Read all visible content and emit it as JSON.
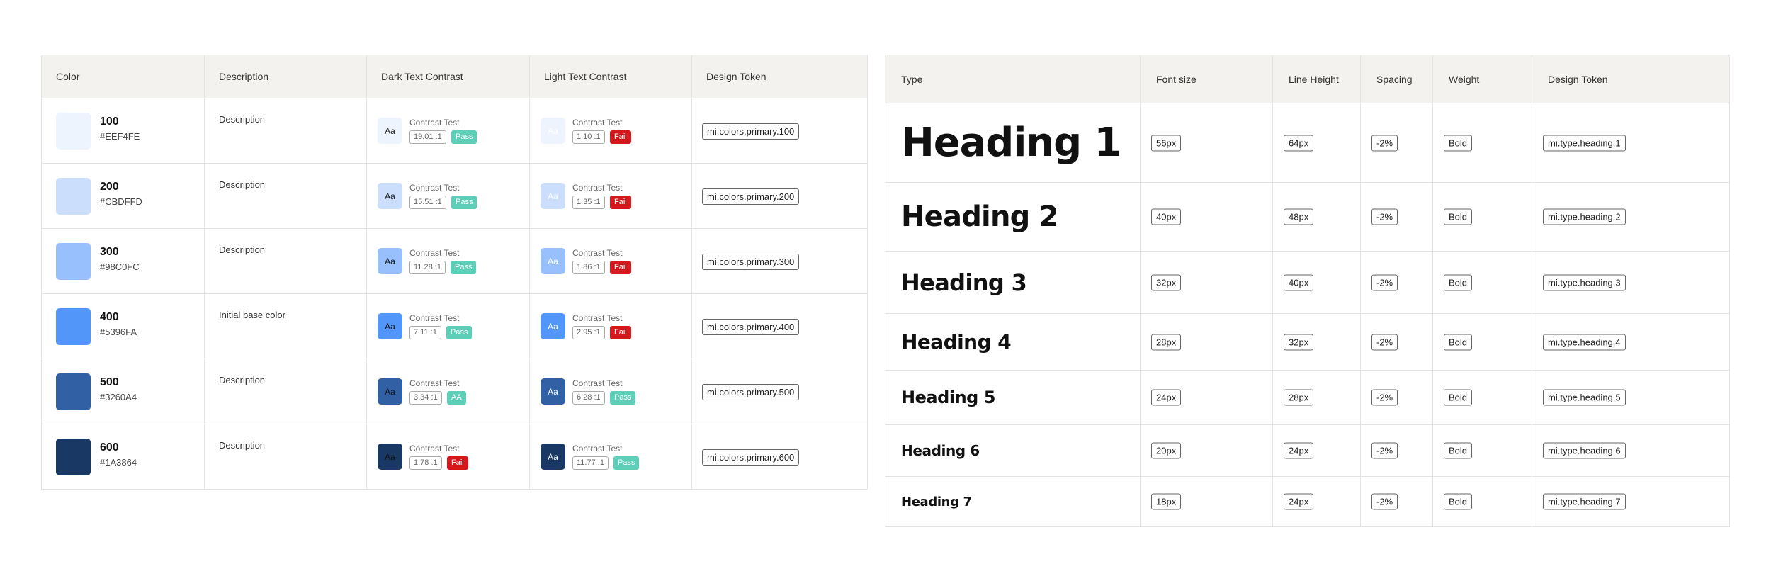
{
  "color_table": {
    "headers": {
      "color": "Color",
      "description": "Description",
      "dark": "Dark Text Contrast",
      "light": "Light Text Contrast",
      "token": "Design Token"
    },
    "rows": [
      {
        "shade": "100",
        "hex": "#EEF4FE",
        "description": "Description",
        "dark": {
          "chip": "Aa",
          "label": "Contrast Test",
          "ratio": "19.01 :1",
          "badge": "Pass"
        },
        "light": {
          "chip": "Aa",
          "label": "Contrast Test",
          "ratio": "1.10 :1",
          "badge": "Fail"
        },
        "token": "mi.colors.primary.100"
      },
      {
        "shade": "200",
        "hex": "#CBDFFD",
        "description": "Description",
        "dark": {
          "chip": "Aa",
          "label": "Contrast Test",
          "ratio": "15.51 :1",
          "badge": "Pass"
        },
        "light": {
          "chip": "Aa",
          "label": "Contrast Test",
          "ratio": "1.35 :1",
          "badge": "Fail"
        },
        "token": "mi.colors.primary.200"
      },
      {
        "shade": "300",
        "hex": "#98C0FC",
        "description": "Description",
        "dark": {
          "chip": "Aa",
          "label": "Contrast Test",
          "ratio": "11.28 :1",
          "badge": "Pass"
        },
        "light": {
          "chip": "Aa",
          "label": "Contrast Test",
          "ratio": "1.86 :1",
          "badge": "Fail"
        },
        "token": "mi.colors.primary.300"
      },
      {
        "shade": "400",
        "hex": "#5396FA",
        "description": "Initial base color",
        "dark": {
          "chip": "Aa",
          "label": "Contrast Test",
          "ratio": "7.11 :1",
          "badge": "Pass"
        },
        "light": {
          "chip": "Aa",
          "label": "Contrast Test",
          "ratio": "2.95 :1",
          "badge": "Fail"
        },
        "token": "mi.colors.primary.400"
      },
      {
        "shade": "500",
        "hex": "#3260A4",
        "description": "Description",
        "dark": {
          "chip": "Aa",
          "label": "Contrast Test",
          "ratio": "3.34 :1",
          "badge": "AA"
        },
        "light": {
          "chip": "Aa",
          "label": "Contrast Test",
          "ratio": "6.28 :1",
          "badge": "Pass"
        },
        "token": "mi.colors.primary.500"
      },
      {
        "shade": "600",
        "hex": "#1A3864",
        "description": "Description",
        "dark": {
          "chip": "Aa",
          "label": "Contrast Test",
          "ratio": "1.78 :1",
          "badge": "Fail"
        },
        "light": {
          "chip": "Aa",
          "label": "Contrast Test",
          "ratio": "11.77 :1",
          "badge": "Pass"
        },
        "token": "mi.colors.primary.600"
      }
    ]
  },
  "type_table": {
    "headers": {
      "type": "Type",
      "size": "Font size",
      "line_height": "Line Height",
      "spacing": "Spacing",
      "weight": "Weight",
      "token": "Design Token"
    },
    "rows": [
      {
        "name": "Heading 1",
        "size": "56px",
        "line_height": "64px",
        "spacing": "-2%",
        "weight": "Bold",
        "token": "mi.type.heading.1"
      },
      {
        "name": "Heading 2",
        "size": "40px",
        "line_height": "48px",
        "spacing": "-2%",
        "weight": "Bold",
        "token": "mi.type.heading.2"
      },
      {
        "name": "Heading 3",
        "size": "32px",
        "line_height": "40px",
        "spacing": "-2%",
        "weight": "Bold",
        "token": "mi.type.heading.3"
      },
      {
        "name": "Heading 4",
        "size": "28px",
        "line_height": "32px",
        "spacing": "-2%",
        "weight": "Bold",
        "token": "mi.type.heading.4"
      },
      {
        "name": "Heading 5",
        "size": "24px",
        "line_height": "28px",
        "spacing": "-2%",
        "weight": "Bold",
        "token": "mi.type.heading.5"
      },
      {
        "name": "Heading 6",
        "size": "20px",
        "line_height": "24px",
        "spacing": "-2%",
        "weight": "Bold",
        "token": "mi.type.heading.6"
      },
      {
        "name": "Heading 7",
        "size": "18px",
        "line_height": "24px",
        "spacing": "-2%",
        "weight": "Bold",
        "token": "mi.type.heading.7"
      }
    ]
  },
  "colors": {
    "pass": "#5dcfb8",
    "aa": "#5dcfb8",
    "fail": "#d4181c",
    "dark_text": "#111111",
    "light_text": "#ffffff"
  }
}
